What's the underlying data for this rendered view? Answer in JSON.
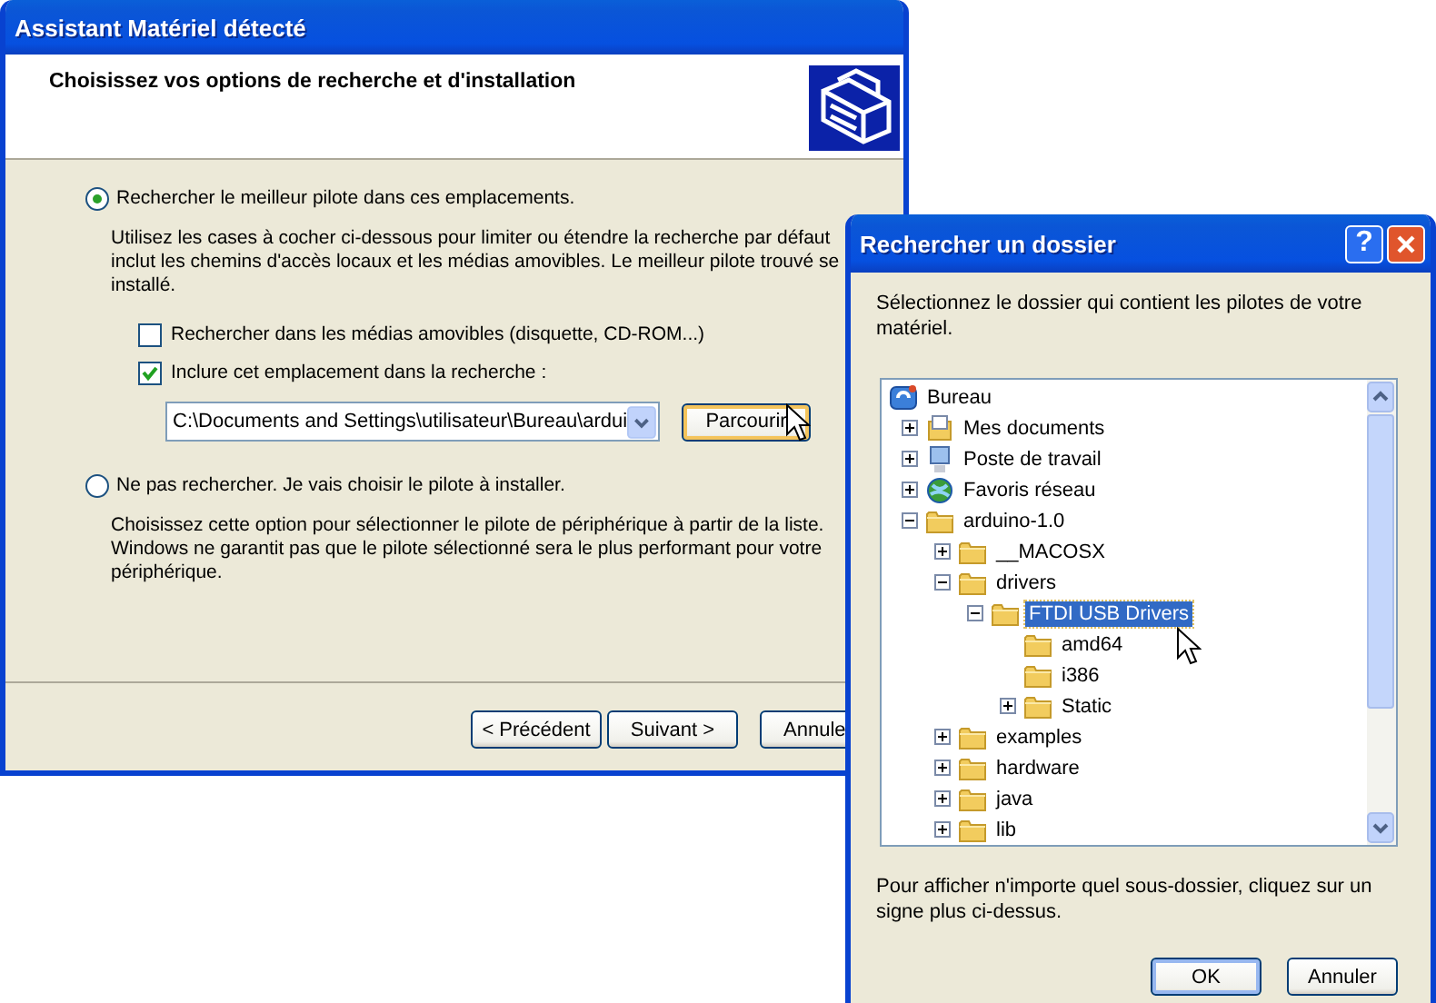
{
  "wizard": {
    "title": "Assistant Matériel détecté",
    "heading": "Choisissez vos options de recherche et d'installation",
    "options": [
      {
        "label": "Rechercher le meilleur pilote dans ces emplacements.",
        "selected": true,
        "description": [
          "Utilisez les cases à cocher ci-dessous pour limiter ou étendre la recherche par défaut",
          "inclut les chemins d'accès locaux et les médias amovibles. Le meilleur pilote trouvé se",
          "installé."
        ]
      },
      {
        "label": "Ne pas rechercher. Je vais choisir le pilote à installer.",
        "selected": false,
        "description": [
          "Choisissez cette option pour sélectionner le pilote de périphérique à partir de la liste.",
          "Windows ne garantit pas que le pilote sélectionné sera le plus performant pour votre",
          "périphérique."
        ]
      }
    ],
    "checkboxes": [
      {
        "label": "Rechercher dans les médias amovibles (disquette, CD-ROM...)",
        "checked": false
      },
      {
        "label": "Inclure cet emplacement dans la recherche :",
        "checked": true
      }
    ],
    "path": "C:\\Documents and Settings\\utilisateur\\Bureau\\ardui",
    "browse_button": "Parcourir",
    "buttons": [
      "< Précédent",
      "Suivant >",
      "Annule"
    ]
  },
  "browse_dialog": {
    "title": "Rechercher un dossier",
    "help_button": "?",
    "instruction": "Sélectionnez le dossier qui contient les pilotes de votre matériel.",
    "tree": {
      "label": "Bureau",
      "kind": "desktop",
      "selected": false,
      "children": [
        {
          "label": "Mes documents",
          "kind": "documents",
          "expanded": false,
          "selected": false
        },
        {
          "label": "Poste de travail",
          "kind": "computer",
          "expanded": false,
          "selected": false
        },
        {
          "label": "Favoris réseau",
          "kind": "network",
          "expanded": false,
          "selected": false
        },
        {
          "label": "arduino-1.0",
          "kind": "folder",
          "expanded": true,
          "selected": false,
          "children": [
            {
              "label": "__MACOSX",
              "kind": "folder",
              "expanded": false,
              "selected": false
            },
            {
              "label": "drivers",
              "kind": "folder",
              "expanded": true,
              "selected": false,
              "children": [
                {
                  "label": "FTDI USB Drivers",
                  "kind": "folder",
                  "expanded": true,
                  "selected": true,
                  "children": [
                    {
                      "label": "amd64",
                      "kind": "folder",
                      "selected": false
                    },
                    {
                      "label": "i386",
                      "kind": "folder",
                      "selected": false
                    },
                    {
                      "label": "Static",
                      "kind": "folder",
                      "expanded": false,
                      "selected": false
                    }
                  ]
                }
              ]
            },
            {
              "label": "examples",
              "kind": "folder",
              "expanded": false,
              "selected": false
            },
            {
              "label": "hardware",
              "kind": "folder",
              "expanded": false,
              "selected": false
            },
            {
              "label": "java",
              "kind": "folder",
              "expanded": false,
              "selected": false
            },
            {
              "label": "lib",
              "kind": "folder",
              "expanded": false,
              "selected": false
            }
          ]
        }
      ]
    },
    "hint": "Pour afficher n'importe quel sous-dossier, cliquez sur un signe plus ci-dessus.",
    "buttons": [
      "OK",
      "Annuler"
    ]
  }
}
